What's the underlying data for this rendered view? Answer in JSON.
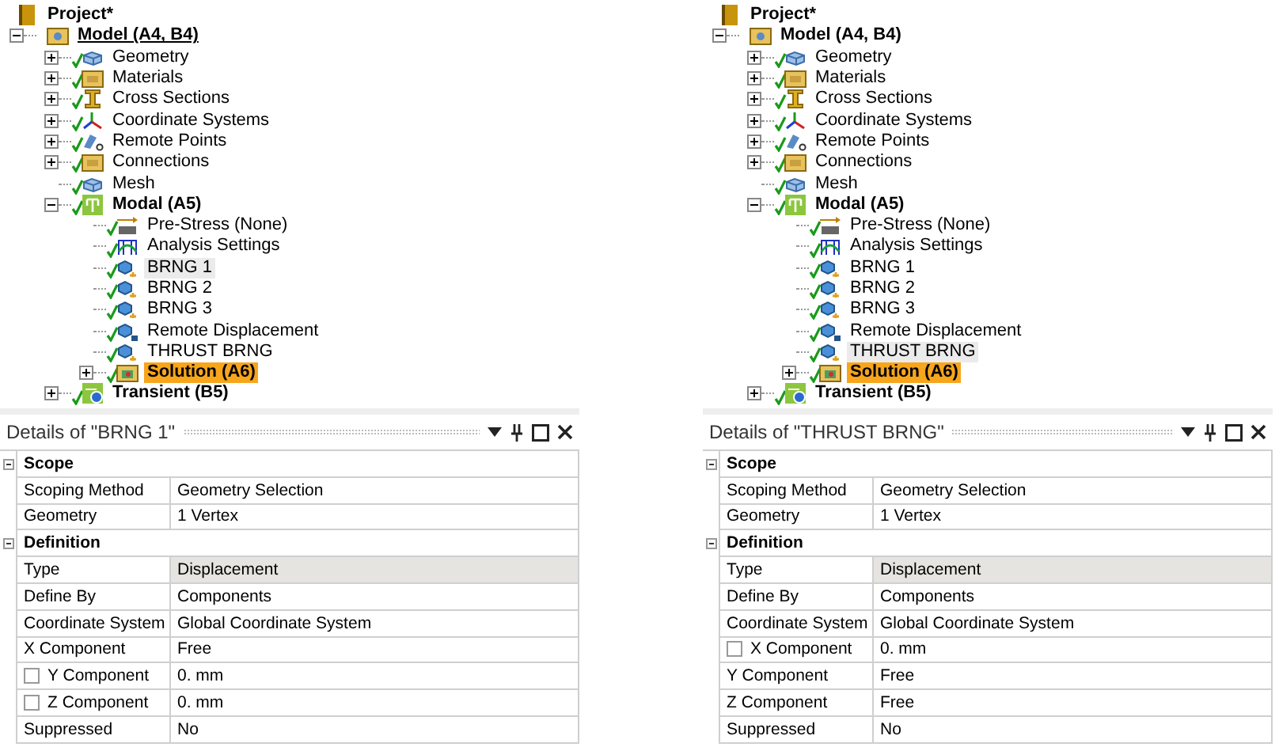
{
  "panels": [
    {
      "tree": {
        "label": "Project*",
        "kind": "project",
        "children": [
          {
            "label": "Model (A4, B4)",
            "kind": "model",
            "bold": true,
            "underline": true,
            "expanded": true,
            "children": [
              {
                "label": "Geometry",
                "kind": "geometry",
                "checked": true,
                "expanded": false
              },
              {
                "label": "Materials",
                "kind": "folder",
                "checked": true,
                "expanded": false
              },
              {
                "label": "Cross Sections",
                "kind": "beam",
                "checked": true,
                "expanded": false
              },
              {
                "label": "Coordinate Systems",
                "kind": "axes",
                "checked": true,
                "expanded": false
              },
              {
                "label": "Remote Points",
                "kind": "remote-point",
                "checked": true,
                "expanded": false
              },
              {
                "label": "Connections",
                "kind": "folder",
                "checked": true,
                "expanded": false
              },
              {
                "label": "Mesh",
                "kind": "geometry",
                "checked": true
              },
              {
                "label": "Modal (A5)",
                "kind": "analysis",
                "bold": true,
                "checked": true,
                "expanded": true,
                "children": [
                  {
                    "label": "Pre-Stress (None)",
                    "kind": "pre-stress",
                    "checked": true
                  },
                  {
                    "label": "Analysis Settings",
                    "kind": "settings",
                    "checked": true
                  },
                  {
                    "label": "BRNG 1",
                    "kind": "support",
                    "checked": true,
                    "focused": true
                  },
                  {
                    "label": "BRNG 2",
                    "kind": "support",
                    "checked": true,
                    "focused": false
                  },
                  {
                    "label": "BRNG 3",
                    "kind": "support",
                    "checked": true,
                    "focused": false
                  },
                  {
                    "label": "Remote Displacement",
                    "kind": "remote-support",
                    "checked": true
                  },
                  {
                    "label": "THRUST BRNG",
                    "kind": "support",
                    "checked": true,
                    "focused": false
                  },
                  {
                    "label": "Solution (A6)",
                    "kind": "solution",
                    "bold": true,
                    "checked": true,
                    "selected": true,
                    "expanded": false
                  }
                ]
              },
              {
                "label": "Transient (B5)",
                "kind": "transient",
                "bold": true,
                "checked": true,
                "expanded": false
              }
            ]
          }
        ]
      },
      "details": {
        "title": "Details of \"BRNG 1\"",
        "groups": [
          {
            "label": "Scope",
            "expanded": true,
            "rows": [
              {
                "label": "Scoping Method",
                "value": "Geometry Selection",
                "selected": false
              },
              {
                "label": "Geometry",
                "value": "1 Vertex",
                "selected": false
              }
            ]
          },
          {
            "label": "Definition",
            "expanded": true,
            "rows": [
              {
                "label": "Type",
                "value": "Displacement",
                "selected": true
              },
              {
                "label": "Define By",
                "value": "Components",
                "selected": false
              },
              {
                "label": "Coordinate System",
                "value": "Global Coordinate System",
                "selected": false
              },
              {
                "label": "X Component",
                "value": "Free",
                "selected": false
              },
              {
                "label": "Y Component",
                "value": "0. mm",
                "selected": false,
                "checkbox": false
              },
              {
                "label": "Z Component",
                "value": "0. mm",
                "selected": false,
                "checkbox": false
              },
              {
                "label": "Suppressed",
                "value": "No",
                "selected": false
              }
            ]
          }
        ]
      }
    },
    {
      "tree": {
        "label": "Project*",
        "kind": "project",
        "children": [
          {
            "label": "Model (A4, B4)",
            "kind": "model",
            "bold": true,
            "underline": false,
            "expanded": true,
            "children": [
              {
                "label": "Geometry",
                "kind": "geometry",
                "checked": true,
                "expanded": false
              },
              {
                "label": "Materials",
                "kind": "folder",
                "checked": true,
                "expanded": false
              },
              {
                "label": "Cross Sections",
                "kind": "beam",
                "checked": true,
                "expanded": false
              },
              {
                "label": "Coordinate Systems",
                "kind": "axes",
                "checked": true,
                "expanded": false
              },
              {
                "label": "Remote Points",
                "kind": "remote-point",
                "checked": true,
                "expanded": false
              },
              {
                "label": "Connections",
                "kind": "folder",
                "checked": true,
                "expanded": false
              },
              {
                "label": "Mesh",
                "kind": "geometry",
                "checked": true
              },
              {
                "label": "Modal (A5)",
                "kind": "analysis",
                "bold": true,
                "checked": true,
                "expanded": true,
                "children": [
                  {
                    "label": "Pre-Stress (None)",
                    "kind": "pre-stress",
                    "checked": true
                  },
                  {
                    "label": "Analysis Settings",
                    "kind": "settings",
                    "checked": true
                  },
                  {
                    "label": "BRNG 1",
                    "kind": "support",
                    "checked": true,
                    "focused": false
                  },
                  {
                    "label": "BRNG 2",
                    "kind": "support",
                    "checked": true,
                    "focused": false
                  },
                  {
                    "label": "BRNG 3",
                    "kind": "support",
                    "checked": true,
                    "focused": false
                  },
                  {
                    "label": "Remote Displacement",
                    "kind": "remote-support",
                    "checked": true
                  },
                  {
                    "label": "THRUST BRNG",
                    "kind": "support",
                    "checked": true,
                    "focused": true
                  },
                  {
                    "label": "Solution (A6)",
                    "kind": "solution",
                    "bold": true,
                    "checked": true,
                    "selected": true,
                    "expanded": false
                  }
                ]
              },
              {
                "label": "Transient (B5)",
                "kind": "transient",
                "bold": true,
                "checked": true,
                "expanded": false
              }
            ]
          }
        ]
      },
      "details": {
        "title": "Details of \"THRUST BRNG\"",
        "groups": [
          {
            "label": "Scope",
            "expanded": true,
            "rows": [
              {
                "label": "Scoping Method",
                "value": "Geometry Selection",
                "selected": false
              },
              {
                "label": "Geometry",
                "value": "1 Vertex",
                "selected": false
              }
            ]
          },
          {
            "label": "Definition",
            "expanded": true,
            "rows": [
              {
                "label": "Type",
                "value": "Displacement",
                "selected": true
              },
              {
                "label": "Define By",
                "value": "Components",
                "selected": false
              },
              {
                "label": "Coordinate System",
                "value": "Global Coordinate System",
                "selected": false
              },
              {
                "label": "X Component",
                "value": "0. mm",
                "selected": false,
                "checkbox": false
              },
              {
                "label": "Y Component",
                "value": "Free",
                "selected": false
              },
              {
                "label": "Z Component",
                "value": "Free",
                "selected": false
              },
              {
                "label": "Suppressed",
                "value": "No",
                "selected": false
              }
            ]
          }
        ]
      }
    }
  ]
}
